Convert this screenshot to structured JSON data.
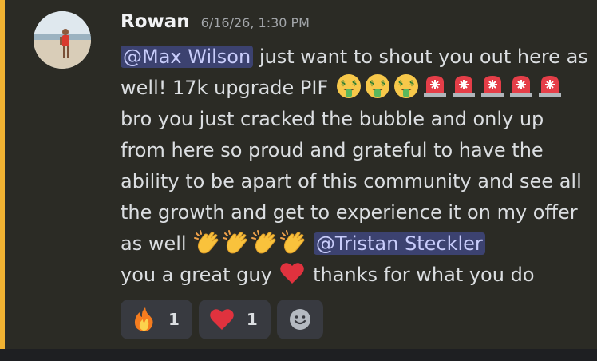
{
  "message": {
    "author": "Rowan",
    "timestamp": "6/16/26, 1:30 PM",
    "accent_color": "#f0b232",
    "mention_1": "@Max Wilson",
    "text_1": " just want to shout you out here as well! 17k upgrade PIF ",
    "text_2": " bro you just cracked the bubble and only up from here so proud and grateful to have the ability to be apart of this community and see all the growth and get to experience it on my offer as well ",
    "mention_2": "@Tristan Steckler",
    "text_3": "you a great guy ",
    "text_4": " thanks for what you do"
  },
  "reactions": [
    {
      "emoji": "fire-icon",
      "count": "1"
    },
    {
      "emoji": "red-heart-icon",
      "count": "1"
    }
  ],
  "add_reaction": {
    "icon": "smiley-add-reaction-icon"
  }
}
